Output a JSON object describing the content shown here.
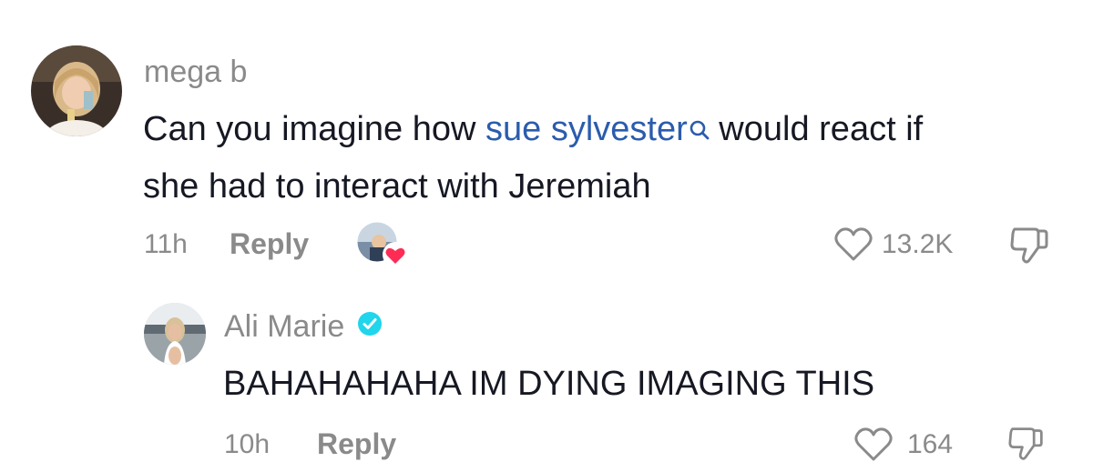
{
  "comments": [
    {
      "username": "mega b",
      "text_before": "Can you imagine how ",
      "mention": "sue sylvester",
      "text_after_line1": " would react if",
      "text_line2": "she had to interact with Jeremiah",
      "time": "11h",
      "reply_label": "Reply",
      "likes": "13.2K",
      "creator_liked": true
    },
    {
      "username": "Ali Marie",
      "verified": true,
      "text": "BAHAHAHAHA IM DYING IMAGING THIS",
      "time": "10h",
      "reply_label": "Reply",
      "likes": "164"
    }
  ],
  "colors": {
    "mention": "#2b5cad",
    "muted": "#8a8a8a",
    "text": "#161823",
    "verified": "#20d5ec",
    "heart": "#fe2c55"
  },
  "icons": [
    "search-icon",
    "heart-outline-icon",
    "thumbs-down-icon",
    "verified-badge-icon",
    "liked-by-creator-icon"
  ]
}
